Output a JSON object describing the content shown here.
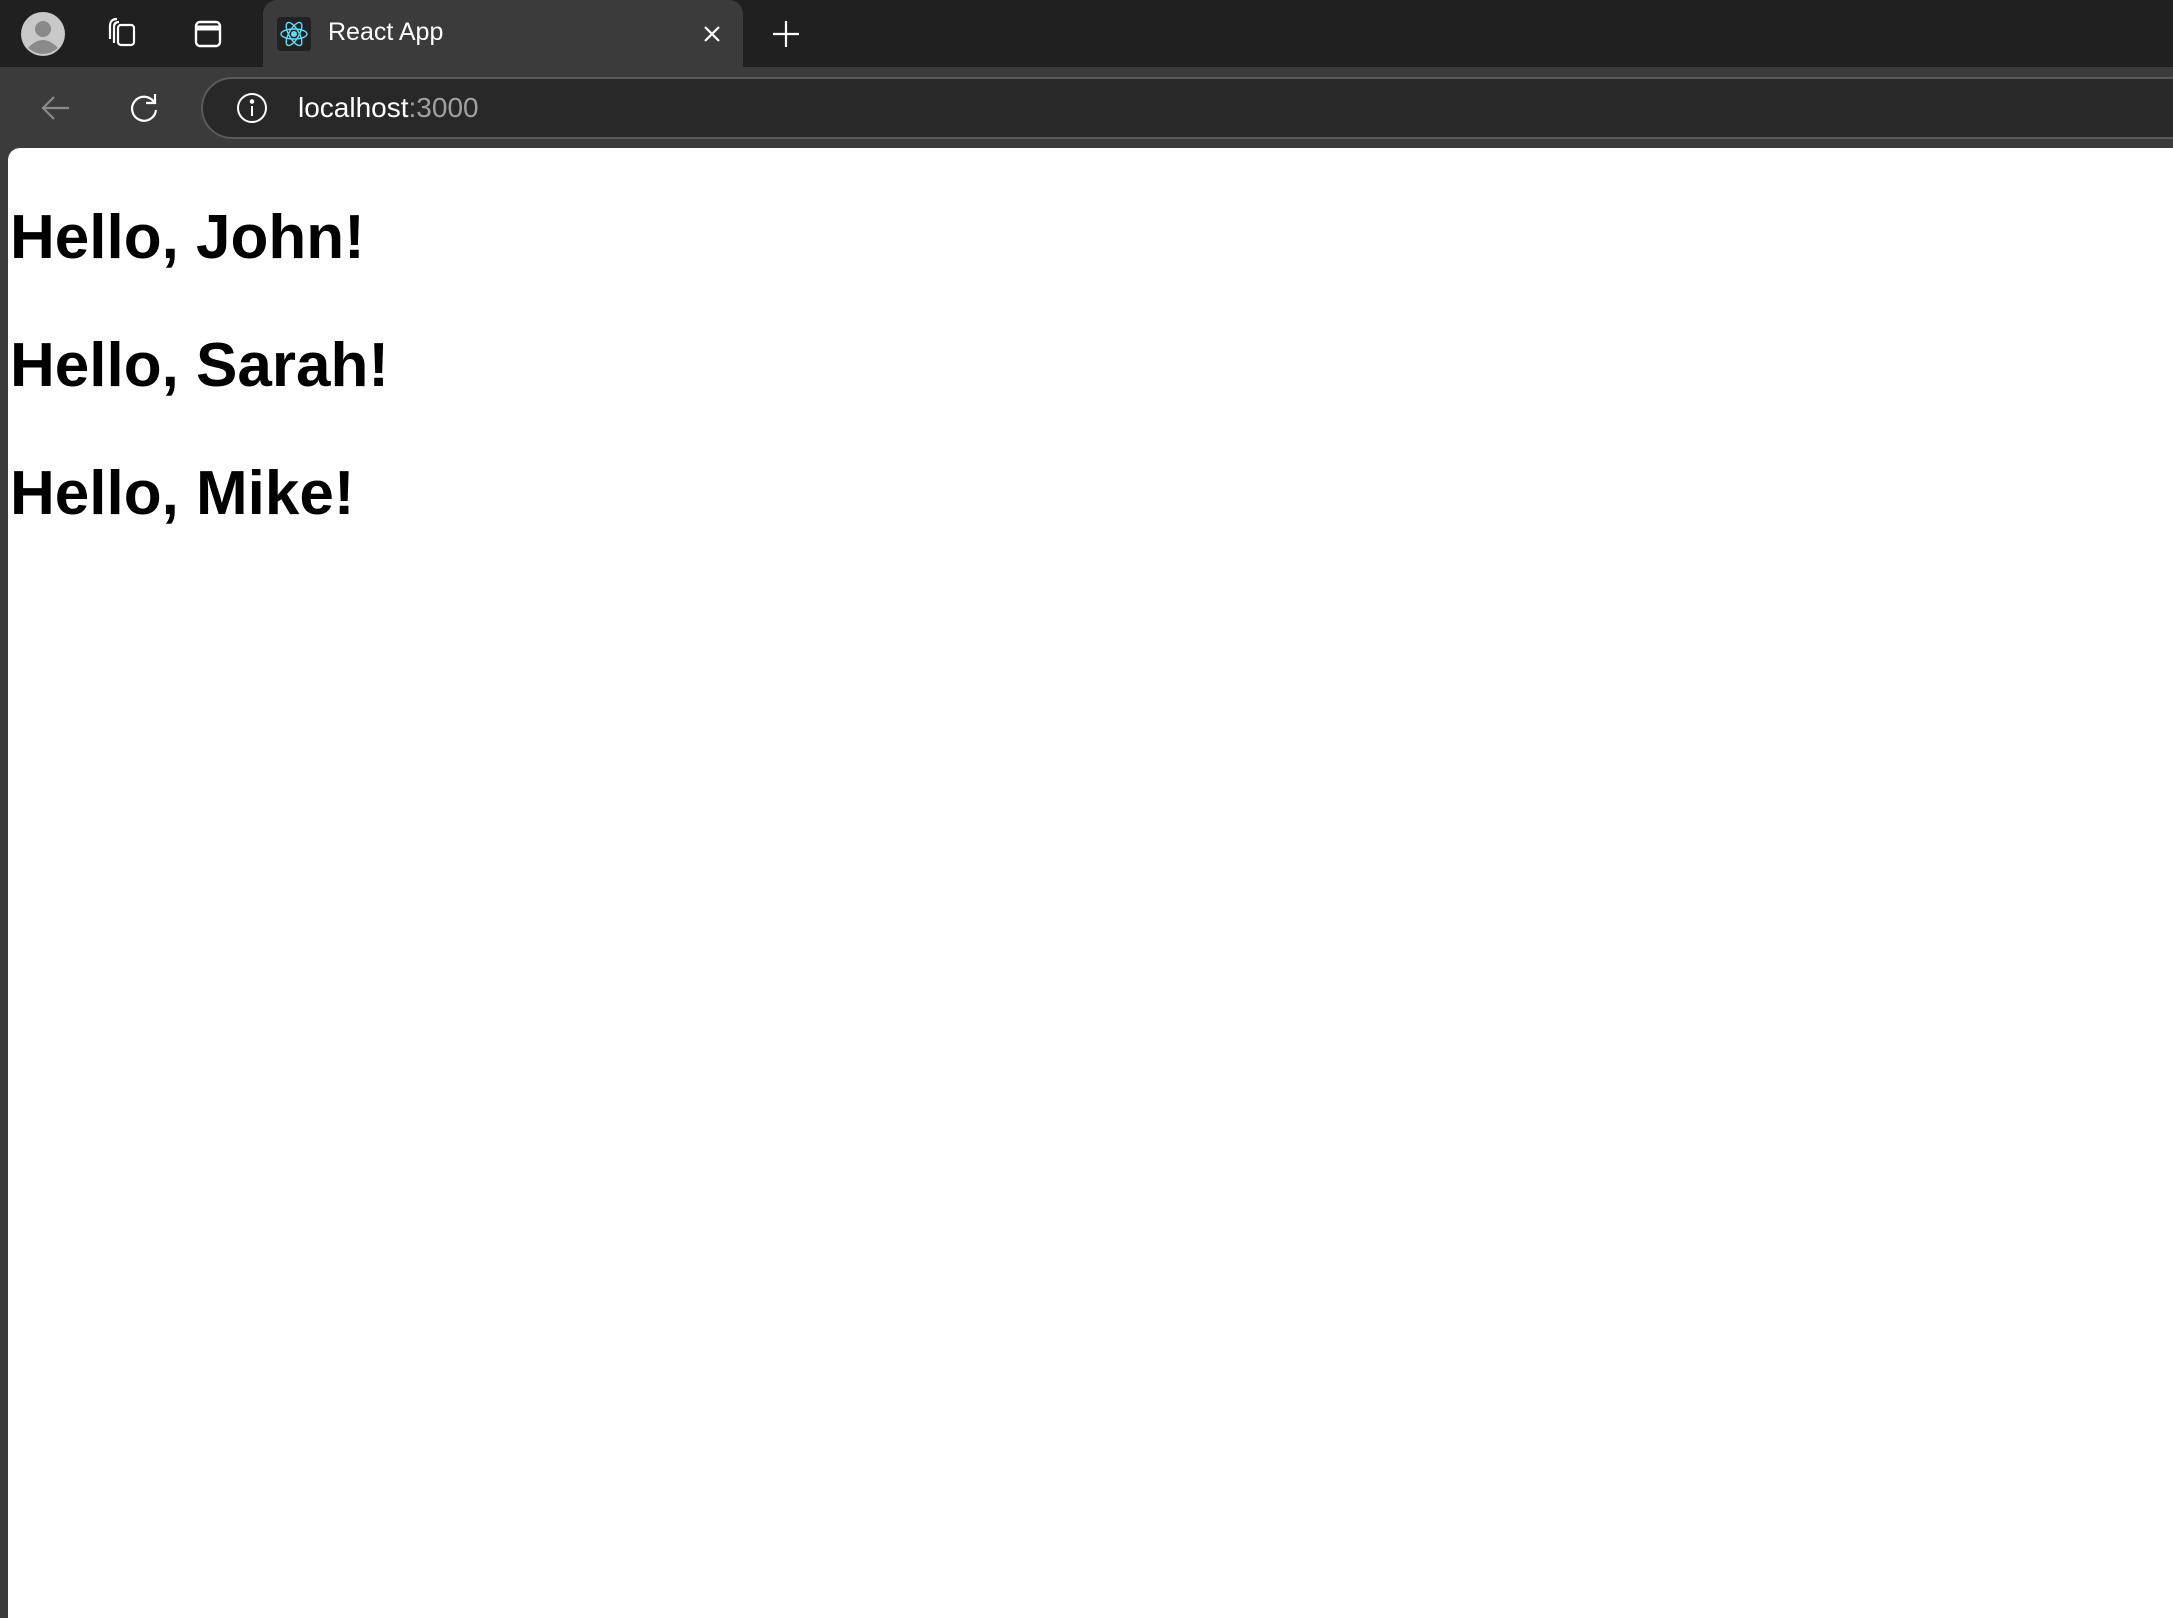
{
  "browser": {
    "tab": {
      "title": "React App"
    },
    "address": {
      "host": "localhost",
      "port": ":3000"
    }
  },
  "page": {
    "greetings": [
      "Hello, John!",
      "Hello, Sarah!",
      "Hello, Mike!"
    ]
  }
}
